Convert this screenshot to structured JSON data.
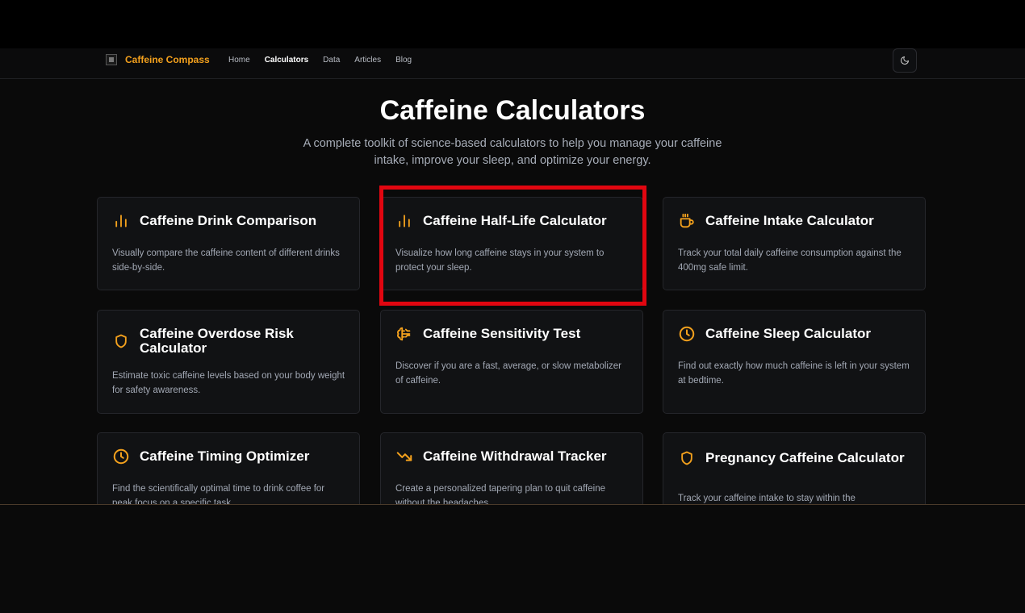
{
  "header": {
    "brand": "Caffeine Compass",
    "nav": [
      {
        "label": "Home",
        "active": false
      },
      {
        "label": "Calculators",
        "active": true
      },
      {
        "label": "Data",
        "active": false
      },
      {
        "label": "Articles",
        "active": false
      },
      {
        "label": "Blog",
        "active": false
      }
    ],
    "theme_toggle_icon": "moon-icon"
  },
  "page": {
    "title": "Caffeine Calculators",
    "subtitle": "A complete toolkit of science-based calculators to help you manage your caffeine intake, improve your sleep, and optimize your energy."
  },
  "colors": {
    "accent": "#f4a11d",
    "highlight": "#e10610",
    "background": "#0a0a0a",
    "card": "#111214"
  },
  "cards": [
    {
      "title": "Caffeine Drink Comparison",
      "desc": "Visually compare the caffeine content of different drinks side-by-side.",
      "icon": "bar-chart-icon"
    },
    {
      "title": "Caffeine Half-Life Calculator",
      "desc": "Visualize how long caffeine stays in your system to protect your sleep.",
      "icon": "bar-chart-icon"
    },
    {
      "title": "Caffeine Intake Calculator",
      "desc": "Track your total daily caffeine consumption against the 400mg safe limit.",
      "icon": "coffee-cup-icon"
    },
    {
      "title": "Caffeine Overdose Risk Calculator",
      "desc": "Estimate toxic caffeine levels based on your body weight for safety awareness.",
      "icon": "shield-icon"
    },
    {
      "title": "Caffeine Sensitivity Test",
      "desc": "Discover if you are a fast, average, or slow metabolizer of caffeine.",
      "icon": "brain-icon"
    },
    {
      "title": "Caffeine Sleep Calculator",
      "desc": "Find out exactly how much caffeine is left in your system at bedtime.",
      "icon": "clock-icon"
    },
    {
      "title": "Caffeine Timing Optimizer",
      "desc": "Find the scientifically optimal time to drink coffee for peak focus on a specific task.",
      "icon": "clock-icon"
    },
    {
      "title": "Caffeine Withdrawal Tracker",
      "desc": "Create a personalized tapering plan to quit caffeine without the headaches.",
      "icon": "trending-down-icon"
    },
    {
      "title": "Pregnancy Caffeine Calculator",
      "desc": "Track your caffeine intake to stay within the",
      "icon": "shield-icon"
    }
  ]
}
